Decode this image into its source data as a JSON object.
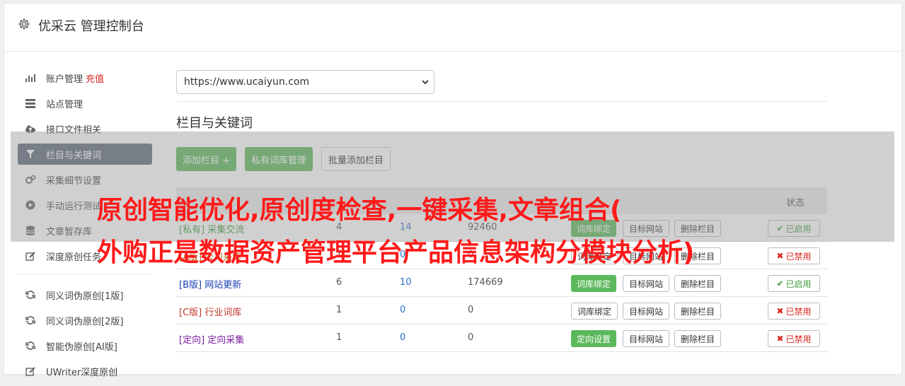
{
  "header": {
    "title": "优采云 管理控制台",
    "icon": "gear-icon"
  },
  "sidebar": {
    "items": [
      {
        "label": "账户管理",
        "extra": "充值",
        "icon": "bar-chart-icon"
      },
      {
        "label": "站点管理",
        "icon": "server-icon"
      },
      {
        "label": "接口文件相关",
        "icon": "cloud-upload-icon"
      },
      {
        "label": "栏目与关键词",
        "icon": "filter-icon",
        "active": true
      },
      {
        "label": "采集细节设置",
        "icon": "cogs-icon"
      },
      {
        "label": "手动运行测试",
        "icon": "play-circle-icon"
      },
      {
        "label": "文章暂存库",
        "icon": "database-icon"
      },
      {
        "label": "深度原创任务",
        "icon": "edit-icon"
      },
      {
        "label": "同义词伪原创[1版]",
        "icon": "refresh-icon"
      },
      {
        "label": "同义词伪原创[2版]",
        "icon": "refresh-icon"
      },
      {
        "label": "智能伪原创[AI版]",
        "icon": "refresh-icon"
      },
      {
        "label": "UWriter深度原创",
        "icon": "edit-icon"
      }
    ]
  },
  "main": {
    "site_select": "https://www.ucaiyun.com",
    "section_title": "栏目与关键词",
    "buttons": {
      "add": "添加栏目 +",
      "private": "私有词库管理",
      "batch": "批量添加栏目"
    },
    "table": {
      "status_header": "状态",
      "rows": [
        {
          "name": "[私有] 采集交流",
          "a": "4",
          "b": "14",
          "c": "92460",
          "op1": "词库绑定",
          "status": "已启用",
          "on": true,
          "color": "#3c9a3c"
        },
        {
          "name": "[A版] 公司采集",
          "a": "1",
          "b": "0",
          "c": "0",
          "op1": "词库绑定",
          "status": "已禁用",
          "on": false,
          "color": "#b5651d"
        },
        {
          "name": "[B版] 网站更新",
          "a": "6",
          "b": "10",
          "c": "174669",
          "op1": "词库绑定",
          "status": "已启用",
          "on": true,
          "color": "#1a3fb5"
        },
        {
          "name": "[C版] 行业词库",
          "a": "1",
          "b": "0",
          "c": "0",
          "op1": "词库绑定",
          "status": "已禁用",
          "on": false,
          "color": "#c0392b"
        },
        {
          "name": "[定向] 定向采集",
          "a": "1",
          "b": "0",
          "c": "0",
          "op1": "定向设置",
          "status": "已禁用",
          "on": false,
          "color": "#7b1fa2"
        }
      ],
      "op2": "目标网站",
      "op3": "删除栏目"
    }
  },
  "overlay": {
    "line1": "原创智能优化,原创度检查,一键采集,文章组合(",
    "line2": "外购正是数据资产管理平台产品信息架构分模块分析)"
  }
}
